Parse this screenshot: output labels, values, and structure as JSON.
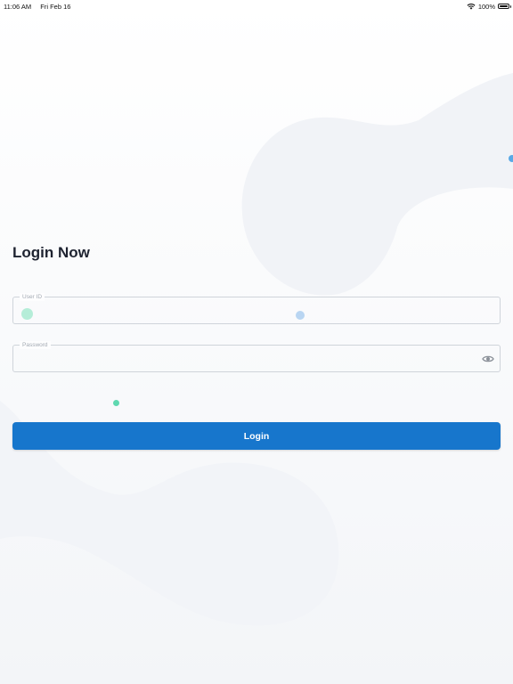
{
  "status_bar": {
    "time": "11:06 AM",
    "date": "Fri Feb 16",
    "battery": "100%",
    "battery_level": 1.0,
    "icons": [
      "wifi-icon",
      "battery-icon"
    ]
  },
  "login": {
    "title": "Login Now",
    "user_id": {
      "label": "User ID",
      "value": ""
    },
    "password": {
      "label": "Password",
      "value": "",
      "toggle_icon": "eye-icon"
    },
    "button_label": "Login"
  },
  "colors": {
    "accent": "#1776cc",
    "background": "#ffffff",
    "field_border": "#cfd4da",
    "dot_green": "#5fd8b0",
    "dot_blue": "#5aa9e6"
  }
}
